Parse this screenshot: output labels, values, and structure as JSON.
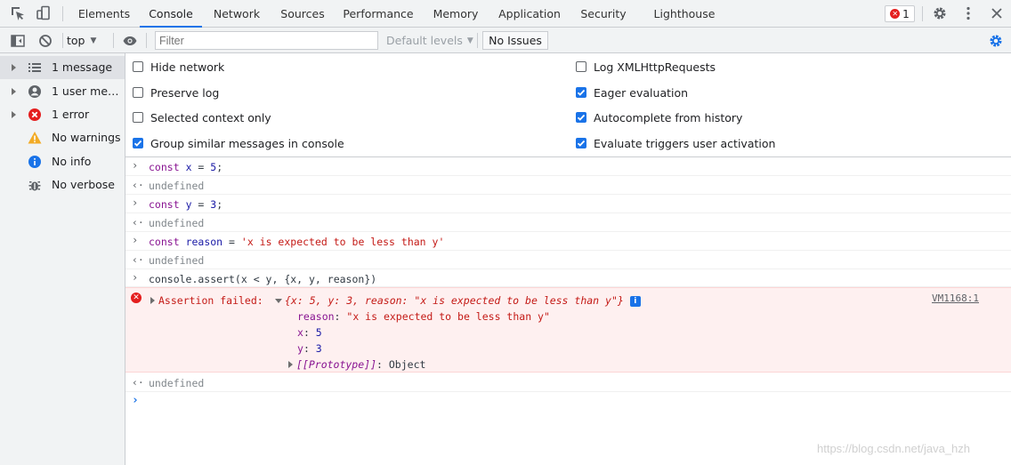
{
  "tabs": [
    {
      "label": "Elements"
    },
    {
      "label": "Console",
      "active": true
    },
    {
      "label": "Network"
    },
    {
      "label": "Sources"
    },
    {
      "label": "Performance"
    },
    {
      "label": "Memory"
    },
    {
      "label": "Application"
    },
    {
      "label": "Security"
    },
    {
      "label": "Lighthouse"
    }
  ],
  "error_badge": {
    "count": "1"
  },
  "toolbar": {
    "context": "top",
    "filter_placeholder": "Filter",
    "levels": "Default levels",
    "issues": "No Issues"
  },
  "sidebar": {
    "items": [
      {
        "label": "1 message",
        "icon": "list-icon"
      },
      {
        "label": "1 user messages",
        "icon": "user-icon"
      },
      {
        "label": "1 error",
        "icon": "error-icon"
      },
      {
        "label": "No warnings",
        "icon": "warning-icon"
      },
      {
        "label": "No info",
        "icon": "info-icon"
      },
      {
        "label": "No verbose",
        "icon": "bug-icon"
      }
    ]
  },
  "settings": {
    "left": [
      {
        "label": "Hide network",
        "checked": false
      },
      {
        "label": "Preserve log",
        "checked": false
      },
      {
        "label": "Selected context only",
        "checked": false
      },
      {
        "label": "Group similar messages in console",
        "checked": true
      }
    ],
    "right": [
      {
        "label": "Log XMLHttpRequests",
        "checked": false
      },
      {
        "label": "Eager evaluation",
        "checked": true
      },
      {
        "label": "Autocomplete from history",
        "checked": true
      },
      {
        "label": "Evaluate triggers user activation",
        "checked": true
      }
    ]
  },
  "console": {
    "undefined_text": "undefined",
    "error": {
      "prefix": "Assertion failed:",
      "summary": "{x: 5, y: 3, reason: \"x is expected to be less than y\"}",
      "source": "VM1168:1",
      "props": [
        {
          "key": "reason",
          "value": "\"x is expected to be less than y\""
        },
        {
          "key": "x",
          "value": "5"
        },
        {
          "key": "y",
          "value": "3"
        }
      ],
      "prototype_key": "[[Prototype]]",
      "prototype_value": "Object"
    }
  },
  "watermark": "https://blog.csdn.net/java_hzh"
}
